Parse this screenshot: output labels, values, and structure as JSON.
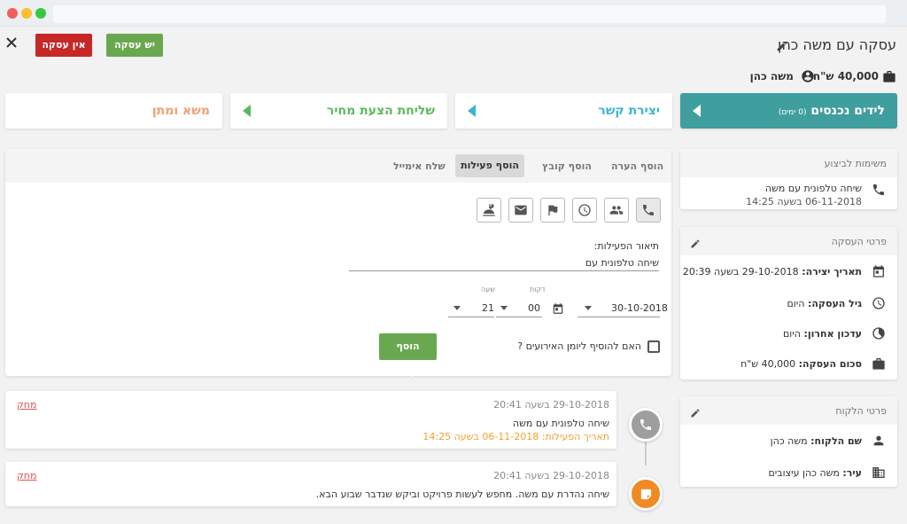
{
  "header": {
    "title": "עסקה עם משה כהן",
    "amount": "40,000 ש\"ח",
    "contact": "משה כהן",
    "btn_won": "יש עסקה",
    "btn_lost": "אין עסקה"
  },
  "stages": [
    {
      "label": "לידים נכנסים",
      "days": "(0 ימים)",
      "color": "#ffffff"
    },
    {
      "label": "יצירת קשר",
      "color": "#3ab4d4"
    },
    {
      "label": "שליחת הצעת מחיר",
      "color": "#5cb85c"
    },
    {
      "label": "משא ומתן",
      "color": "#f0a070"
    }
  ],
  "tabs": [
    "הוסף הערה",
    "הוסף קובץ",
    "הוסף פעילות",
    "שלח אימייל"
  ],
  "activity_form": {
    "desc_label": "תיאור הפעילות:",
    "desc_value": "שיחה טלפונית עם",
    "date": "30-10-2018",
    "minutes_label": "דקות",
    "minutes": "00",
    "hour_label": "שעה",
    "hour": "21",
    "checkbox_label": "האם להוסיף ליומן האירועים ?",
    "submit": "הוסף פעילות"
  },
  "timeline": [
    {
      "time": "29-10-2018 בשעה 20:41",
      "text": "שיחה טלפונית עם משה",
      "sub": "תאריך הפעילות: 06-11-2018 בשעה 14:25",
      "delete": "מחק"
    },
    {
      "time": "29-10-2018 בשעה 20:41",
      "text": "שיחה נהדרת עם משה. מחפש לעשות פרויקט וביקש שנדבר שבוע הבא.",
      "delete": "מחק"
    }
  ],
  "tasks": {
    "title": "משימות לביצוע",
    "item_title": "שיחה טלפונית עם משה",
    "item_date": "06-11-2018 בשעה 14:25"
  },
  "deal_details": {
    "title": "פרטי העסקה",
    "created_label": "תאריך יצירה:",
    "created": "29-10-2018 בשעה 20:39",
    "age_label": "גיל העסקה:",
    "age": "היום",
    "updated_label": "עדכון אחרון:",
    "updated": "היום",
    "sum_label": "סכום העסקה:",
    "sum": "40,000 ש\"ח"
  },
  "client": {
    "title": "פרטי הלקוח",
    "name_label": "שם הלקוח:",
    "name": "משה כהן",
    "city_label": "עיר:",
    "city": "משה כהן עיצובים"
  }
}
